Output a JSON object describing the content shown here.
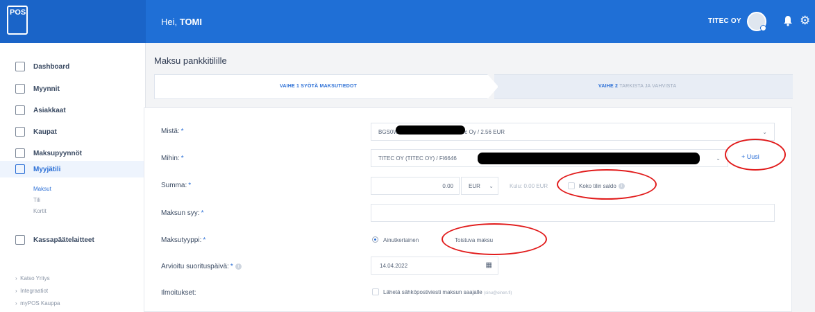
{
  "topbar": {
    "logo_text": "POS",
    "greeting_prefix": "Hei, ",
    "user_name": "TOMI",
    "company": "TITEC OY",
    "accent_color": "#1f6fd6"
  },
  "sidebar": {
    "items": [
      {
        "label": "Dashboard",
        "icon": "dashboard-icon"
      },
      {
        "label": "Myynnit",
        "icon": "sales-chart-icon"
      },
      {
        "label": "Asiakkaat",
        "icon": "customers-icon"
      },
      {
        "label": "Kaupat",
        "icon": "shop-icon"
      },
      {
        "label": "Maksupyynnöt",
        "icon": "payment-request-icon"
      },
      {
        "label": "Myyjätili",
        "icon": "account-icon",
        "active": true
      },
      {
        "label": "Kassapäätelaitteet",
        "icon": "terminal-icon"
      }
    ],
    "sub_items": [
      "Maksut",
      "Tili",
      "Kortit"
    ],
    "external_links": [
      "Katso Yritys",
      "Integraatiot",
      "myPOS Kauppa"
    ]
  },
  "main": {
    "page_title": "Maksu pankkitilille",
    "step1": {
      "number": "VAIHE 1",
      "text": "SYÖTÄ MAKSUTIEDOT"
    },
    "step2": {
      "number": "VAIHE 2",
      "text": "TARKISTA JA VAHVISTA"
    },
    "form": {
      "mista_label": "Mistä:",
      "mista_value_start": "BGS0W",
      "mista_value_end": "/ Titec Oy / 2.56 EUR",
      "mihin_label": "Mihin:",
      "mihin_value": "TITEC OY (TITEC OY) / FI6646",
      "uusi_label": "+ Uusi",
      "summa_label": "Summa:",
      "summa_value": "0.00",
      "currency": "EUR",
      "kulu_text": "Kulu: 0.00 EUR",
      "koko_saldo_label": "Koko tilin saldo",
      "syy_label": "Maksun syy:",
      "tyyppi_label": "Maksutyyppi:",
      "tyyppi_option1": "Ainutkertainen",
      "tyyppi_option2": "Toistuva maksu",
      "date_label": "Arvioitu suorituspäivä:",
      "date_value": "14.04.2022",
      "ilmoitukset_label": "Ilmoitukset:",
      "email_notify_label": "Lähetä sähköpostiviesti maksun saajalle",
      "email_hint": "(sinu@oinen.fi)"
    }
  },
  "annotation_color": "#e11b1b"
}
